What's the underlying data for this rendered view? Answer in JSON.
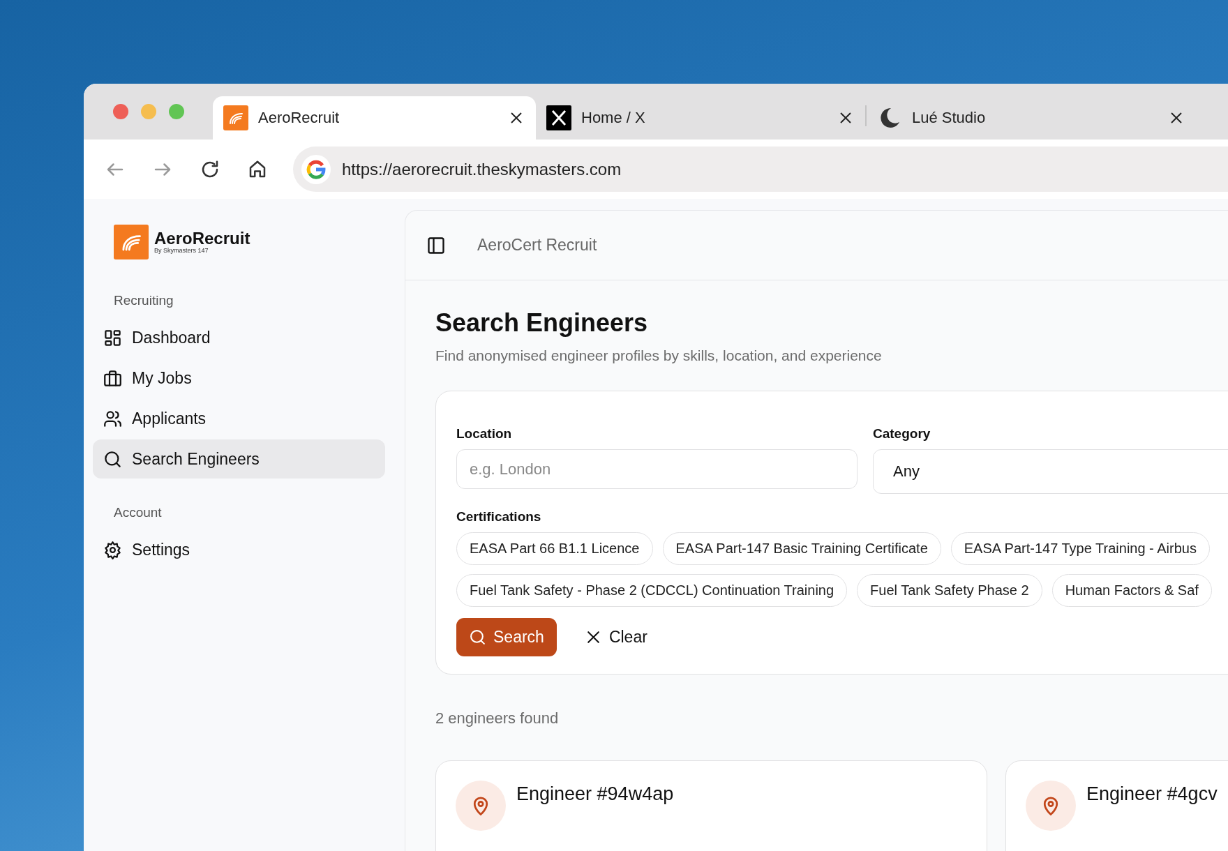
{
  "browser": {
    "tabs": [
      {
        "title": "AeroRecruit",
        "selected": true
      },
      {
        "title": "Home / X",
        "selected": false
      },
      {
        "title": "Lué Studio",
        "selected": false
      }
    ],
    "url": "https://aerorecruit.theskymasters.com"
  },
  "sidebar": {
    "logo": {
      "name": "AeroRecruit",
      "tagline": "By Skymasters 147"
    },
    "sections": [
      {
        "heading": "Recruiting",
        "items": [
          {
            "label": "Dashboard",
            "selected": false
          },
          {
            "label": "My Jobs",
            "selected": false
          },
          {
            "label": "Applicants",
            "selected": false
          },
          {
            "label": "Search Engineers",
            "selected": true
          }
        ]
      },
      {
        "heading": "Account",
        "items": [
          {
            "label": "Settings",
            "selected": false
          }
        ]
      }
    ]
  },
  "header": {
    "title": "AeroCert Recruit"
  },
  "page": {
    "title": "Search Engineers",
    "subtitle": "Find anonymised engineer profiles by skills, location, and experience"
  },
  "filters": {
    "location": {
      "label": "Location",
      "placeholder": "e.g. London"
    },
    "category": {
      "label": "Category",
      "value": "Any"
    },
    "certifications": {
      "label": "Certifications",
      "rows": [
        [
          "EASA Part 66 B1.1 Licence",
          "EASA Part-147 Basic Training Certificate",
          "EASA Part-147 Type Training - Airbus"
        ],
        [
          "Fuel Tank Safety - Phase 2 (CDCCL) Continuation Training",
          "Fuel Tank Safety Phase 2",
          "Human Factors & Saf"
        ]
      ]
    },
    "buttons": [
      {
        "label": "Search",
        "kind": "primary"
      },
      {
        "label": "Clear",
        "kind": "plain"
      }
    ]
  },
  "results": {
    "count": "2 engineers found",
    "engineers": [
      {
        "name": "Engineer #94w4ap"
      },
      {
        "name": "Engineer #4gcv"
      }
    ]
  }
}
